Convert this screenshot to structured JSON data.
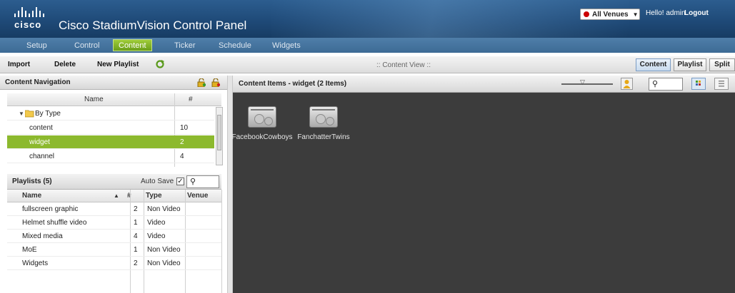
{
  "header": {
    "brand": "cisco",
    "title": "Cisco StadiumVision Control Panel",
    "venue_select": "All Venues",
    "greeting": "Hello! admin",
    "logout": "Logout"
  },
  "tabs": [
    "Setup",
    "Control",
    "Content",
    "Ticker",
    "Schedule",
    "Widgets"
  ],
  "active_tab": "Content",
  "toolbar": {
    "import": "Import",
    "delete": "Delete",
    "new_playlist": "New Playlist",
    "content_view": ":: Content View ::",
    "views": [
      "Content",
      "Playlist",
      "Split"
    ]
  },
  "content_nav": {
    "title": "Content Navigation",
    "col_name": "Name",
    "col_count": "#",
    "group": "By Type",
    "rows": [
      {
        "name": "content",
        "count": "10"
      },
      {
        "name": "widget",
        "count": "2"
      },
      {
        "name": "channel",
        "count": "4"
      }
    ]
  },
  "playlists": {
    "title": "Playlists (5)",
    "auto_save": "Auto Save",
    "columns": {
      "name": "Name",
      "count": "#",
      "type": "Type",
      "venue": "Venue"
    },
    "rows": [
      {
        "name": "fullscreen graphic",
        "count": "2",
        "type": "Non Video"
      },
      {
        "name": "Helmet shuffle video",
        "count": "1",
        "type": "Video"
      },
      {
        "name": "Mixed media",
        "count": "4",
        "type": "Video"
      },
      {
        "name": "MoE",
        "count": "1",
        "type": "Non Video"
      },
      {
        "name": "Widgets",
        "count": "2",
        "type": "Non Video"
      }
    ]
  },
  "content_items": {
    "title": "Content Items - widget (2 Items)",
    "items": [
      {
        "name": "FacebookCowboys"
      },
      {
        "name": "FanchatterTwins"
      }
    ]
  },
  "colors": {
    "header_blue": "#1f4a78",
    "accent_green": "#8cb92e",
    "content_bg": "#3c3c3c"
  },
  "icons": [
    "refresh-icon",
    "folder-open-icon",
    "lock-icon",
    "unlock-icon",
    "search-icon",
    "grid-view-icon",
    "list-view-icon",
    "person-icon",
    "checkbox-icon"
  ]
}
